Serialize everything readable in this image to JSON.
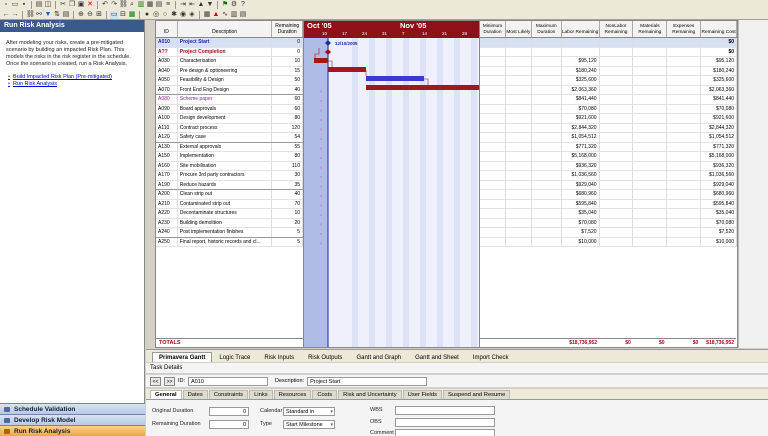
{
  "left_pane": {
    "title": "Run Risk Analysis",
    "description": "After modeling your risks, create a pre-mitigated scenario by building an impacted Risk Plan. This models the risks in the risk register in the schedule. Once the scenario is created, run a Risk Analysis.",
    "links": [
      "Build Impacted Risk Plan (Pre-mitigated)",
      "Run Risk Analysis"
    ],
    "nav": [
      {
        "label": "Schedule Validation"
      },
      {
        "label": "Develop Risk Model"
      },
      {
        "label": "Run Risk Analysis"
      }
    ]
  },
  "grid": {
    "headers": {
      "id": "ID",
      "desc": "Description",
      "dur": "Remaining Duration"
    },
    "rows": [
      {
        "id": "A010",
        "desc": "Project Start",
        "dur": "0",
        "style": "ms",
        "selected": true
      },
      {
        "id": "A??",
        "desc": "Project Completion",
        "dur": "0",
        "style": "msr"
      },
      {
        "id": "A030",
        "desc": "Characterisation",
        "dur": "10"
      },
      {
        "id": "A040",
        "desc": "Pre design & optioneering",
        "dur": "15"
      },
      {
        "id": "A050",
        "desc": "Feasibility & Design",
        "dur": "50"
      },
      {
        "id": "A070",
        "desc": "Front End Eng Design",
        "dur": "40",
        "group": true
      },
      {
        "id": "A080",
        "desc": "Scheme paper",
        "dur": "60",
        "style": "pink"
      },
      {
        "id": "A090",
        "desc": "Board approvals",
        "dur": "60"
      },
      {
        "id": "A100",
        "desc": "Design development",
        "dur": "80"
      },
      {
        "id": "A110",
        "desc": "Contract process",
        "dur": "120"
      },
      {
        "id": "A120",
        "desc": "Safety case",
        "dur": "54",
        "group": true
      },
      {
        "id": "A130",
        "desc": "External approvals",
        "dur": "55"
      },
      {
        "id": "A150",
        "desc": "Implementation",
        "dur": "80"
      },
      {
        "id": "A160",
        "desc": "Site mobilisation",
        "dur": "110"
      },
      {
        "id": "A170",
        "desc": "Procure 3rd party contractors",
        "dur": "30"
      },
      {
        "id": "A190",
        "desc": "Reduce hazards",
        "dur": "35",
        "group": true
      },
      {
        "id": "A200",
        "desc": "Clean strip out",
        "dur": "40"
      },
      {
        "id": "A210",
        "desc": "Contaminated strip out",
        "dur": "70"
      },
      {
        "id": "A220",
        "desc": "Decontaminate structures",
        "dur": "10"
      },
      {
        "id": "A230",
        "desc": "Building demolition",
        "dur": "20"
      },
      {
        "id": "A240",
        "desc": "Post implementation finishes",
        "dur": "5",
        "group": true
      },
      {
        "id": "A250",
        "desc": "Final report, historic records and cl...",
        "dur": "5"
      }
    ],
    "totals_label": "TOTALS"
  },
  "gantt": {
    "months": [
      {
        "label": "Oct '05"
      },
      {
        "label": "Nov '05"
      }
    ],
    "days": [
      "10",
      "17",
      "24",
      "31",
      "7",
      "14",
      "21",
      "28"
    ],
    "milestone_label": "12/10/2005"
  },
  "right_grid": {
    "headers": {
      "min": "Minimum Duration",
      "like": "Most Likely",
      "max": "Maximum Duration",
      "lab": "Labor Remaining",
      "nlab": "NonLabor Remaining",
      "mat": "Materials Remaining",
      "exp": "Expenses Remaining",
      "cost": "Remaining Cost"
    },
    "rows": [
      {
        "lab": "",
        "nlab": "",
        "mat": "",
        "exp": "",
        "cost": "$0",
        "bold": true
      },
      {
        "lab": "",
        "nlab": "",
        "mat": "",
        "exp": "",
        "cost": "$0",
        "bold": true
      },
      {
        "lab": "$95,120",
        "cost": "$95,120"
      },
      {
        "lab": "$180,240",
        "cost": "$180,240"
      },
      {
        "lab": "$325,600",
        "cost": "$325,600"
      },
      {
        "lab": "$2,063,360",
        "cost": "$2,063,360"
      },
      {
        "lab": "$841,440",
        "cost": "$841,440"
      },
      {
        "lab": "$70,080",
        "cost": "$70,080"
      },
      {
        "lab": "$921,600",
        "cost": "$921,600"
      },
      {
        "lab": "$2,844,320",
        "cost": "$2,844,320"
      },
      {
        "lab": "$1,054,512",
        "cost": "$1,054,512"
      },
      {
        "lab": "$771,320",
        "cost": "$771,320"
      },
      {
        "lab": "$5,168,000",
        "cost": "$5,168,000"
      },
      {
        "lab": "$936,320",
        "cost": "$936,320"
      },
      {
        "lab": "$1,036,560",
        "cost": "$1,036,560"
      },
      {
        "lab": "$929,040",
        "cost": "$929,040"
      },
      {
        "lab": "$680,960",
        "cost": "$680,960"
      },
      {
        "lab": "$595,840",
        "cost": "$595,840"
      },
      {
        "lab": "$35,040",
        "cost": "$35,040"
      },
      {
        "lab": "$70,080",
        "cost": "$70,080"
      },
      {
        "lab": "$7,520",
        "cost": "$7,520"
      },
      {
        "lab": "$10,000",
        "cost": "$10,000"
      }
    ],
    "totals": {
      "lab": "$18,736,952",
      "nlab": "$0",
      "mat": "$0",
      "exp": "$0",
      "cost": "$18,736,952"
    }
  },
  "view_tabs": [
    "Primavera Gantt",
    "Logic Trace",
    "Risk Inputs",
    "Risk Outputs",
    "Gantt and Graph",
    "Gantt and Sheet",
    "Import Check"
  ],
  "task_details": {
    "title": "Task Details",
    "prev": "<<",
    "next": ">>",
    "id_label": "ID:",
    "id_value": "A010",
    "desc_label": "Description:",
    "desc_value": "Project Start"
  },
  "detail_tabs": [
    "General",
    "Dates",
    "Constraints",
    "Links",
    "Resources",
    "Costs",
    "Risk and Uncertainty",
    "User Fields",
    "Suspend and Resume"
  ],
  "form": {
    "orig_dur_label": "Original Duration",
    "orig_dur_value": "0",
    "rem_dur_label": "Remaining Duration",
    "rem_dur_value": "0",
    "calendar_label": "Calendar",
    "calendar_value": "Standard in",
    "type_label": "Type",
    "type_value": "Start Milestone",
    "wbs_label": "WBS",
    "obs_label": "OBS",
    "comment_label": "Comment"
  }
}
